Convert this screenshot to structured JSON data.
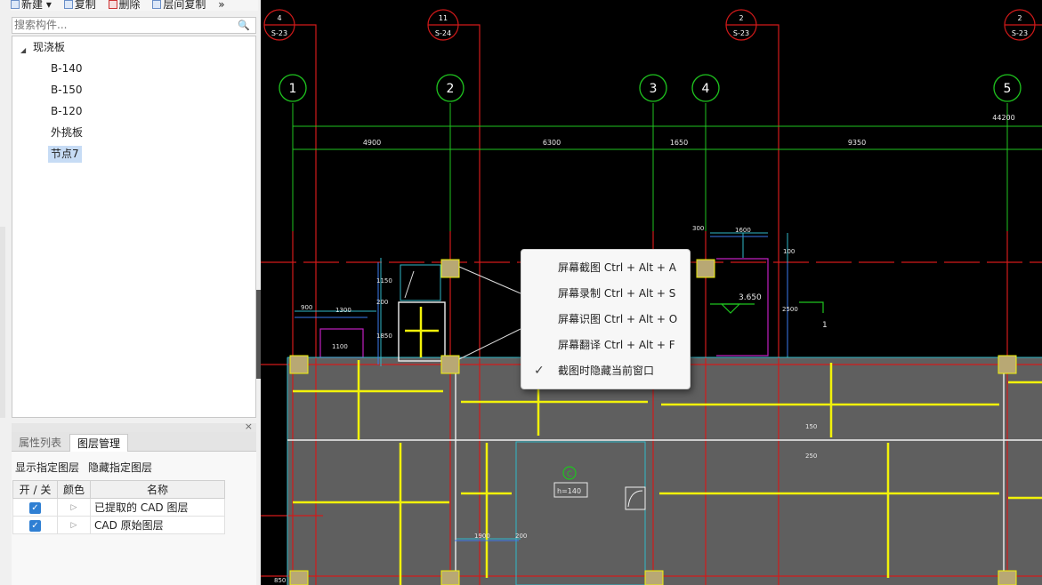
{
  "toolbar": {
    "new_label": "新建",
    "copy_label": "复制",
    "delete_label": "删除",
    "floor_copy_label": "层间复制",
    "more_label": "»"
  },
  "search": {
    "placeholder": "搜索构件..."
  },
  "tree": {
    "root_label": "现浇板",
    "items": [
      "B-140",
      "B-150",
      "B-120",
      "外挑板",
      "节点7"
    ],
    "selected": "节点7"
  },
  "panel": {
    "tabs": [
      "属性列表",
      "图层管理"
    ],
    "active_tab": "图层管理",
    "show_layer_label": "显示指定图层",
    "hide_layer_label": "隐藏指定图层",
    "columns": [
      "开 / 关",
      "颜色",
      "名称"
    ],
    "layers": [
      {
        "on": true,
        "name": "已提取的 CAD 图层"
      },
      {
        "on": true,
        "name": "CAD 原始图层"
      }
    ]
  },
  "context_menu": {
    "items": [
      {
        "label": "屏幕截图 Ctrl + Alt + A",
        "checked": false
      },
      {
        "label": "屏幕录制 Ctrl + Alt + S",
        "checked": false
      },
      {
        "label": "屏幕识图 Ctrl + Alt + O",
        "checked": false
      },
      {
        "label": "屏幕翻译 Ctrl + Alt + F",
        "checked": false
      },
      {
        "label": "截图时隐藏当前窗口",
        "checked": true
      }
    ]
  },
  "cad": {
    "section_bubbles": [
      {
        "num": "4",
        "sheet": "S-23"
      },
      {
        "num": "11",
        "sheet": "S-24"
      },
      {
        "num": "2",
        "sheet": "S-23"
      },
      {
        "num": "2",
        "sheet": "S-23"
      }
    ],
    "axis_bubbles": [
      "1",
      "2",
      "3",
      "4",
      "5"
    ],
    "total_dim": "44200",
    "dims": [
      "4900",
      "6300",
      "1650",
      "9350"
    ],
    "misc_labels": [
      "300",
      "1600",
      "100",
      "900",
      "1300",
      "1150",
      "200",
      "1850",
      "1100",
      "3.650",
      "2500",
      "1",
      "150",
      "250",
      "1900",
      "200",
      "850"
    ],
    "slab_label": "h=140",
    "slab_mark": "C"
  },
  "colors": {
    "canvas": "#000000",
    "axis_green": "#1fc41f",
    "red": "#d21a1a",
    "cyan": "#2fb8c8",
    "yellow": "#f2f20a",
    "slab_fill": "#5f5f5f",
    "magenta": "#c020c0"
  }
}
